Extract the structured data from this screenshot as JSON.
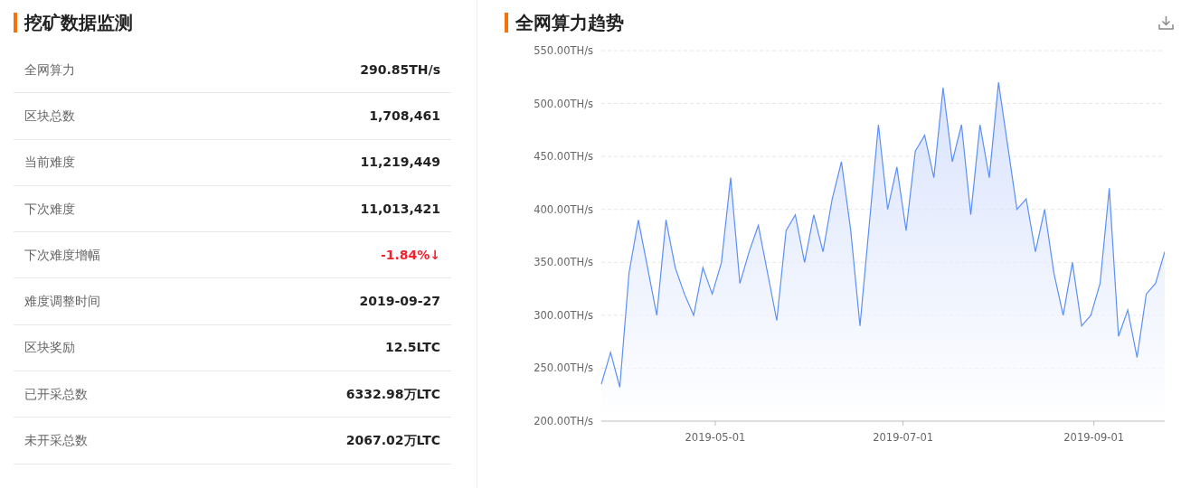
{
  "stats_panel": {
    "title": "挖矿数据监测",
    "rows": [
      {
        "label": "全网算力",
        "value": "290.85TH/s"
      },
      {
        "label": "区块总数",
        "value": "1,708,461"
      },
      {
        "label": "当前难度",
        "value": "11,219,449"
      },
      {
        "label": "下次难度",
        "value": "11,013,421"
      },
      {
        "label": "下次难度增幅",
        "value": "-1.84%↓",
        "color": "#f5222d"
      },
      {
        "label": "难度调整时间",
        "value": "2019-09-27"
      },
      {
        "label": "区块奖励",
        "value": "12.5LTC"
      },
      {
        "label": "已开采总数",
        "value": "6332.98万LTC"
      },
      {
        "label": "未开采总数",
        "value": "2067.02万LTC"
      }
    ]
  },
  "chart_panel": {
    "title": "全网算力趋势",
    "chart_data": {
      "type": "area",
      "x": [
        "2019-03-25",
        "2019-03-28",
        "2019-03-31",
        "2019-04-03",
        "2019-04-06",
        "2019-04-09",
        "2019-04-12",
        "2019-04-15",
        "2019-04-18",
        "2019-04-21",
        "2019-04-24",
        "2019-04-27",
        "2019-04-30",
        "2019-05-03",
        "2019-05-06",
        "2019-05-09",
        "2019-05-12",
        "2019-05-15",
        "2019-05-18",
        "2019-05-21",
        "2019-05-24",
        "2019-05-27",
        "2019-05-30",
        "2019-06-02",
        "2019-06-05",
        "2019-06-08",
        "2019-06-11",
        "2019-06-14",
        "2019-06-17",
        "2019-06-20",
        "2019-06-23",
        "2019-06-26",
        "2019-06-29",
        "2019-07-02",
        "2019-07-05",
        "2019-07-08",
        "2019-07-11",
        "2019-07-14",
        "2019-07-17",
        "2019-07-20",
        "2019-07-23",
        "2019-07-26",
        "2019-07-29",
        "2019-08-01",
        "2019-08-04",
        "2019-08-07",
        "2019-08-10",
        "2019-08-13",
        "2019-08-16",
        "2019-08-19",
        "2019-08-22",
        "2019-08-25",
        "2019-08-28",
        "2019-08-31",
        "2019-09-03",
        "2019-09-06",
        "2019-09-09",
        "2019-09-12",
        "2019-09-15",
        "2019-09-18",
        "2019-09-21",
        "2019-09-24"
      ],
      "series": [
        {
          "color": "#5b8ff9",
          "values": [
            235,
            265,
            232,
            340,
            390,
            345,
            300,
            390,
            345,
            320,
            300,
            345,
            320,
            350,
            430,
            330,
            360,
            385,
            340,
            295,
            380,
            395,
            350,
            395,
            360,
            410,
            445,
            380,
            290,
            385,
            480,
            400,
            440,
            380,
            455,
            470,
            430,
            515,
            445,
            480,
            395,
            480,
            430,
            520,
            460,
            400,
            410,
            360,
            400,
            340,
            300,
            350,
            290,
            300,
            330,
            420,
            280,
            305,
            260,
            320,
            330,
            360
          ]
        }
      ],
      "xlim": [
        "2019-03-25",
        "2019-09-24"
      ],
      "ylim": [
        200,
        550
      ],
      "grid": true,
      "yticks": [
        {
          "value": 200,
          "label": "200.00TH/s"
        },
        {
          "value": 250,
          "label": "250.00TH/s"
        },
        {
          "value": 300,
          "label": "300.00TH/s"
        },
        {
          "value": 350,
          "label": "350.00TH/s"
        },
        {
          "value": 400,
          "label": "400.00TH/s"
        },
        {
          "value": 450,
          "label": "450.00TH/s"
        },
        {
          "value": 500,
          "label": "500.00TH/s"
        },
        {
          "value": 550,
          "label": "550.00TH/s"
        }
      ],
      "xticks": [
        {
          "value": "2019-05-01",
          "label": "2019-05-01"
        },
        {
          "value": "2019-07-01",
          "label": "2019-07-01"
        },
        {
          "value": "2019-09-01",
          "label": "2019-09-01"
        }
      ]
    }
  }
}
